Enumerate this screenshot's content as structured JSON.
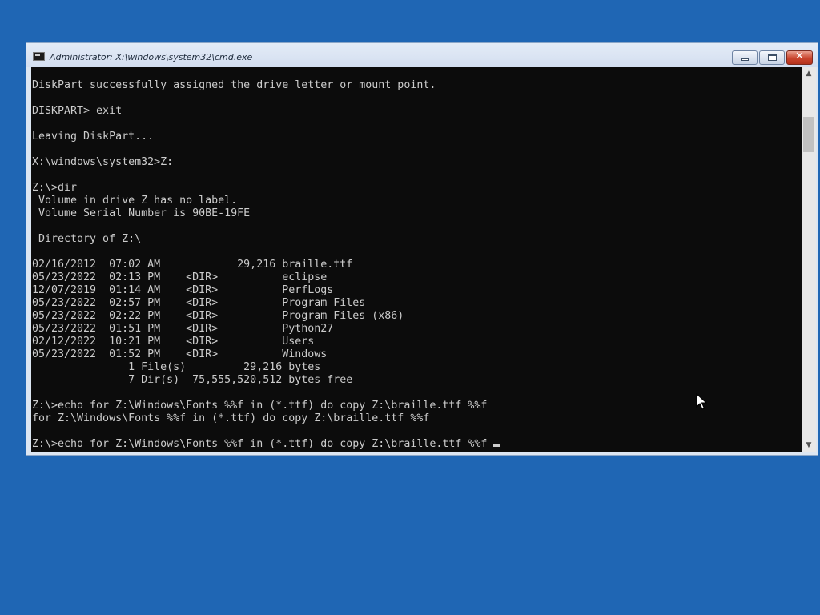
{
  "window": {
    "title": "Administrator: X:\\windows\\system32\\cmd.exe",
    "icon": "console-icon",
    "buttons": {
      "minimize": "minimize-icon",
      "maximize": "maximize-icon",
      "close_glyph": "✕"
    }
  },
  "console": {
    "lines": [
      "DiskPart successfully assigned the drive letter or mount point.",
      "",
      "DISKPART> exit",
      "",
      "Leaving DiskPart...",
      "",
      "X:\\windows\\system32>Z:",
      "",
      "Z:\\>dir",
      " Volume in drive Z has no label.",
      " Volume Serial Number is 90BE-19FE",
      "",
      " Directory of Z:\\",
      "",
      "02/16/2012  07:02 AM            29,216 braille.ttf",
      "05/23/2022  02:13 PM    <DIR>          eclipse",
      "12/07/2019  01:14 AM    <DIR>          PerfLogs",
      "05/23/2022  02:57 PM    <DIR>          Program Files",
      "05/23/2022  02:22 PM    <DIR>          Program Files (x86)",
      "05/23/2022  01:51 PM    <DIR>          Python27",
      "02/12/2022  10:21 PM    <DIR>          Users",
      "05/23/2022  01:52 PM    <DIR>          Windows",
      "               1 File(s)         29,216 bytes",
      "               7 Dir(s)  75,555,520,512 bytes free",
      "",
      "Z:\\>echo for Z:\\Windows\\Fonts %%f in (*.ttf) do copy Z:\\braille.ttf %%f",
      "for Z:\\Windows\\Fonts %%f in (*.ttf) do copy Z:\\braille.ttf %%f",
      ""
    ],
    "current_input": "Z:\\>echo for Z:\\Windows\\Fonts %%f in (*.ttf) do copy Z:\\braille.ttf %%f "
  },
  "colors": {
    "desktop": "#1f66b4",
    "console_bg": "#0c0c0c",
    "console_text": "#cccccc"
  }
}
